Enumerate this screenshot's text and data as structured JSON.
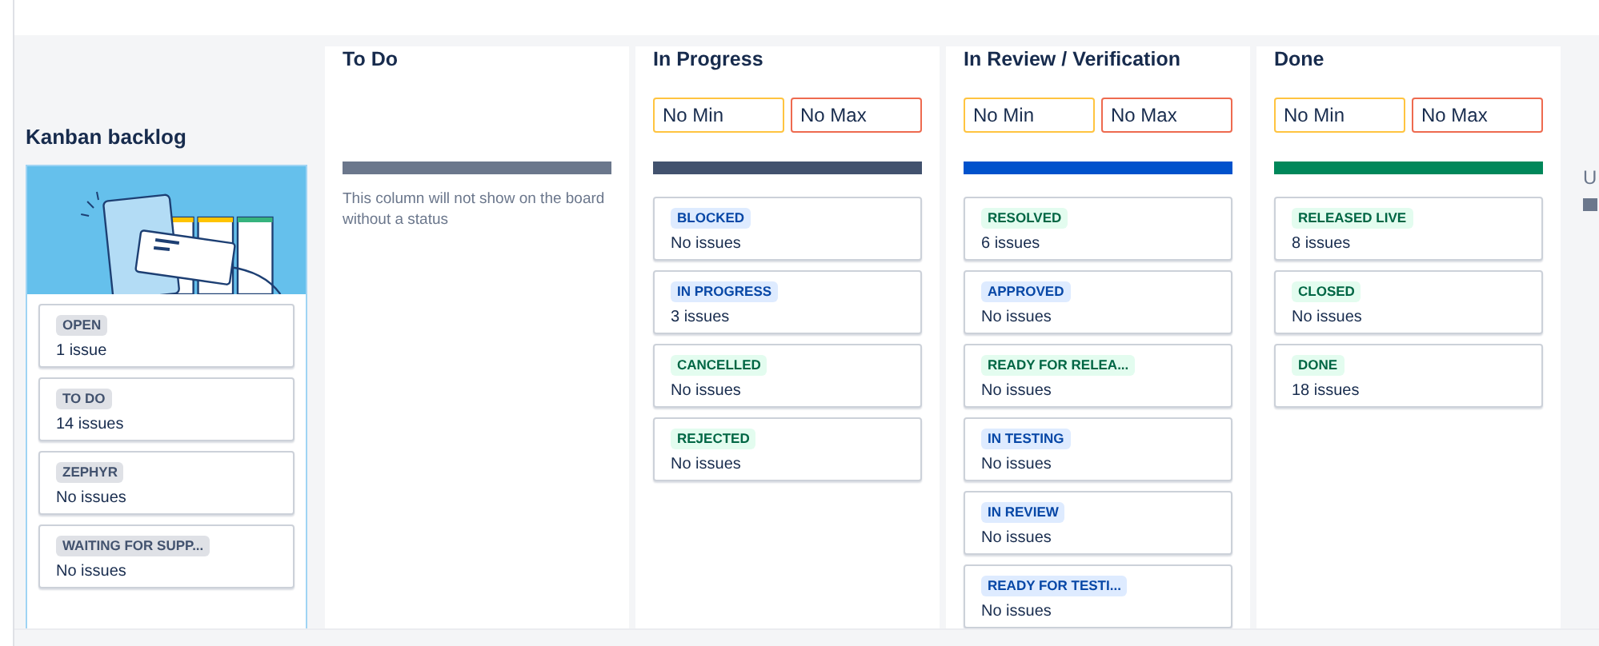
{
  "backlog": {
    "title": "Kanban backlog",
    "statuses": [
      {
        "label": "OPEN",
        "kind": "todo",
        "count": "1 issue"
      },
      {
        "label": "TO DO",
        "kind": "todo",
        "count": "14 issues"
      },
      {
        "label": "ZEPHYR",
        "kind": "todo",
        "count": "No issues"
      },
      {
        "label": "WAITING FOR SUPP...",
        "kind": "todo",
        "count": "No issues"
      }
    ]
  },
  "columns": [
    {
      "title": "To Do",
      "color": "#6b778c",
      "note": "This column will not show on the board without a status"
    },
    {
      "title": "In Progress",
      "color": "#42526e",
      "min_placeholder": "No Min",
      "max_placeholder": "No Max",
      "statuses": [
        {
          "label": "BLOCKED",
          "kind": "inprogress",
          "count": "No issues"
        },
        {
          "label": "IN PROGRESS",
          "kind": "inprogress",
          "count": "3 issues"
        },
        {
          "label": "CANCELLED",
          "kind": "done",
          "count": "No issues"
        },
        {
          "label": "REJECTED",
          "kind": "done",
          "count": "No issues"
        }
      ]
    },
    {
      "title": "In Review / Verification",
      "color": "#0052cc",
      "min_placeholder": "No Min",
      "max_placeholder": "No Max",
      "statuses": [
        {
          "label": "RESOLVED",
          "kind": "done",
          "count": "6 issues"
        },
        {
          "label": "APPROVED",
          "kind": "inprogress",
          "count": "No issues"
        },
        {
          "label": "READY FOR RELEA...",
          "kind": "done",
          "count": "No issues"
        },
        {
          "label": "IN TESTING",
          "kind": "inprogress",
          "count": "No issues"
        },
        {
          "label": "IN REVIEW",
          "kind": "inprogress",
          "count": "No issues"
        },
        {
          "label": "READY FOR TESTI...",
          "kind": "inprogress",
          "count": "No issues"
        }
      ]
    },
    {
      "title": "Done",
      "color": "#00875a",
      "min_placeholder": "No Min",
      "max_placeholder": "No Max",
      "statuses": [
        {
          "label": "RELEASED LIVE",
          "kind": "done",
          "count": "8 issues"
        },
        {
          "label": "CLOSED",
          "kind": "done",
          "count": "No issues"
        },
        {
          "label": "DONE",
          "kind": "done",
          "count": "18 issues"
        }
      ]
    }
  ],
  "partial_column": {
    "title": "U",
    "color": "#6b778c"
  }
}
